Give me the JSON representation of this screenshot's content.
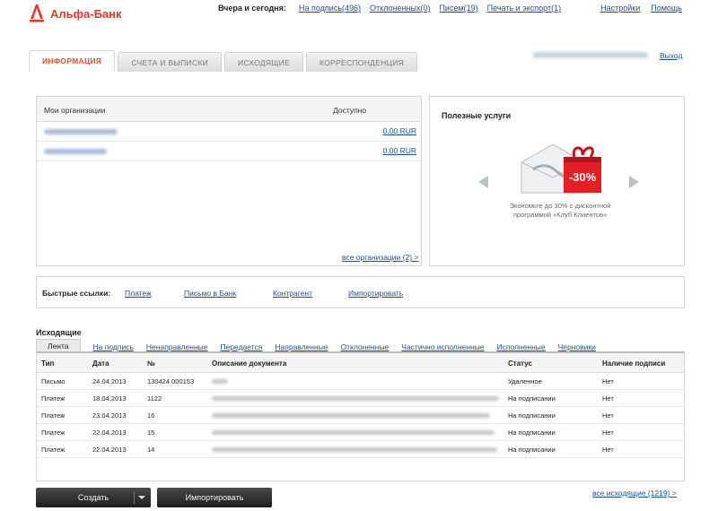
{
  "header": {
    "logo_text": "Альфа-Банк",
    "period_label": "Вчера и сегодня:",
    "links": [
      "На подпись(496)",
      "Отклоненных(0)",
      "Писем(19)",
      "Печать и экспорт(1)"
    ],
    "settings": "Настройки",
    "help": "Помощь",
    "logout": "Выход"
  },
  "tabs": [
    {
      "label": "ИНФОРМАЦИЯ",
      "active": true
    },
    {
      "label": "СЧЕТА И ВЫПИСКИ",
      "active": false
    },
    {
      "label": "ИСХОДЯЩИЕ",
      "active": false
    },
    {
      "label": "КОРРЕСПОНДЕНЦИЯ",
      "active": false
    }
  ],
  "orgs": {
    "col_org": "Мои организации",
    "col_available": "Доступно",
    "rows": [
      {
        "amount": "0.00 RUR"
      },
      {
        "amount": "0.00 RUR"
      }
    ],
    "all_link": "все организации (2) >"
  },
  "services": {
    "title": "Полезные услуги",
    "discount_badge": "-30%",
    "caption": "Экономьте до 30% с дисконтной программой «Клуб Клиентов»"
  },
  "quick_links": {
    "label": "Быстрые ссылки:",
    "items": [
      "Платеж",
      "Письмо в Банк",
      "Контрагент",
      "Импортировать"
    ]
  },
  "outgoing": {
    "title": "Исходящие",
    "filters": [
      "Лента",
      "На подпись",
      "Ненаправленные",
      "Передается",
      "Направленные",
      "Отклоненные",
      "Частично исполненные",
      "Исполненные",
      "Черновики"
    ],
    "columns": {
      "type": "Тип",
      "date": "Дата",
      "number": "№",
      "description": "Описание документа",
      "status": "Статус",
      "signature": "Наличие подписи"
    },
    "rows": [
      {
        "type": "Письмо",
        "date": "24.04.2013",
        "number": "130424 000153",
        "status": "Удаленное",
        "signature": "Нет"
      },
      {
        "type": "Платеж",
        "date": "18.04.2013",
        "number": "1122",
        "status": "На подписании",
        "signature": "Нет"
      },
      {
        "type": "Платеж",
        "date": "23.04.2013",
        "number": "16",
        "status": "На подписании",
        "signature": "Нет"
      },
      {
        "type": "Платеж",
        "date": "22.04.2013",
        "number": "15",
        "status": "На подписании",
        "signature": "Нет"
      },
      {
        "type": "Платеж",
        "date": "22.04.2013",
        "number": "14",
        "status": "На подписании",
        "signature": "Нет"
      }
    ],
    "all_link": "все исходящие (1219) >"
  },
  "buttons": {
    "create": "Создать",
    "import": "Импортировать"
  },
  "colors": {
    "brand_red": "#ef3124",
    "link_blue": "#1a4f9c",
    "active_tab": "#e84c2b"
  }
}
